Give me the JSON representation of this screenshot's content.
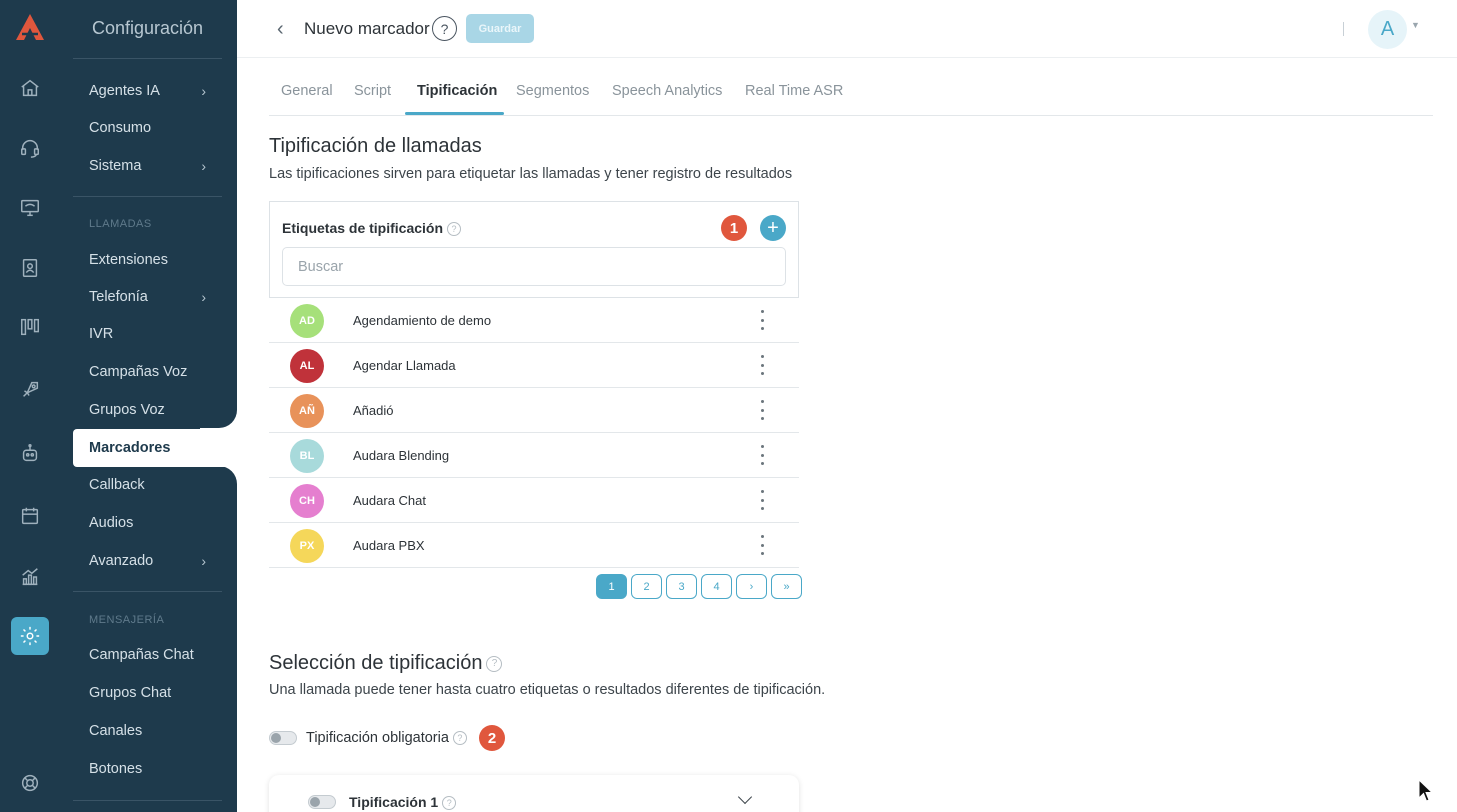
{
  "sidebar": {
    "title": "Configuración",
    "items_top": [
      {
        "label": "Agentes IA",
        "has_submenu": true
      },
      {
        "label": "Consumo",
        "has_submenu": false
      },
      {
        "label": "Sistema",
        "has_submenu": true
      }
    ],
    "section_calls": "LLAMADAS",
    "items_calls": [
      {
        "label": "Extensiones",
        "has_submenu": false
      },
      {
        "label": "Telefonía",
        "has_submenu": true
      },
      {
        "label": "IVR",
        "has_submenu": false
      },
      {
        "label": "Campañas Voz",
        "has_submenu": false
      },
      {
        "label": "Grupos Voz",
        "has_submenu": false
      },
      {
        "label": "Marcadores",
        "has_submenu": false,
        "active": true
      },
      {
        "label": "Callback",
        "has_submenu": false
      },
      {
        "label": "Audios",
        "has_submenu": false
      },
      {
        "label": "Avanzado",
        "has_submenu": true
      }
    ],
    "section_messaging": "MENSAJERÍA",
    "items_messaging": [
      {
        "label": "Campañas Chat"
      },
      {
        "label": "Grupos Chat"
      },
      {
        "label": "Canales"
      },
      {
        "label": "Botones"
      }
    ]
  },
  "header": {
    "back_icon": "chevron-left-icon",
    "title": "Nuevo marcador",
    "help_label": "?",
    "save_label": "Guardar",
    "avatar_initial": "A"
  },
  "tabs": [
    {
      "label": "General"
    },
    {
      "label": "Script"
    },
    {
      "label": "Tipificación",
      "active": true
    },
    {
      "label": "Segmentos"
    },
    {
      "label": "Speech Analytics"
    },
    {
      "label": "Real Time ASR"
    }
  ],
  "labels_section": {
    "title": "Tipificación de llamadas",
    "description": "Las tipificaciones sirven para etiquetar las llamadas y tener registro de resultados",
    "card_label": "Etiquetas de tipificación",
    "help_label": "?",
    "badge": "1",
    "add_label": "+",
    "search_placeholder": "Buscar",
    "search_value": "",
    "rows": [
      {
        "initials": "AD",
        "name": "Agendamiento de demo",
        "color": "#a6e07a"
      },
      {
        "initials": "AL",
        "name": "Agendar Llamada",
        "color": "#c0323a"
      },
      {
        "initials": "AÑ",
        "name": "Añadió",
        "color": "#e8925a"
      },
      {
        "initials": "BL",
        "name": "Audara Blending",
        "color": "#a8dadb"
      },
      {
        "initials": "CH",
        "name": "Audara Chat",
        "color": "#e57fcf"
      },
      {
        "initials": "PX",
        "name": "Audara PBX",
        "color": "#f5d75a"
      }
    ],
    "pagination": [
      "1",
      "2",
      "3",
      "4",
      "›",
      "»"
    ],
    "current_page": "1"
  },
  "selection_section": {
    "title": "Selección de tipificación",
    "help_label": "?",
    "description": "Una llamada puede tener hasta cuatro etiquetas o resultados diferentes de tipificación.",
    "mandatory_label": "Tipificación obligatoria",
    "mandatory_enabled": false,
    "badge": "2",
    "tip1_label": "Tipificación 1",
    "tip1_enabled": false
  },
  "colors": {
    "sidebar_bg": "#1e3a4c",
    "accent": "#4aa8c8",
    "badge": "#e0573d"
  }
}
